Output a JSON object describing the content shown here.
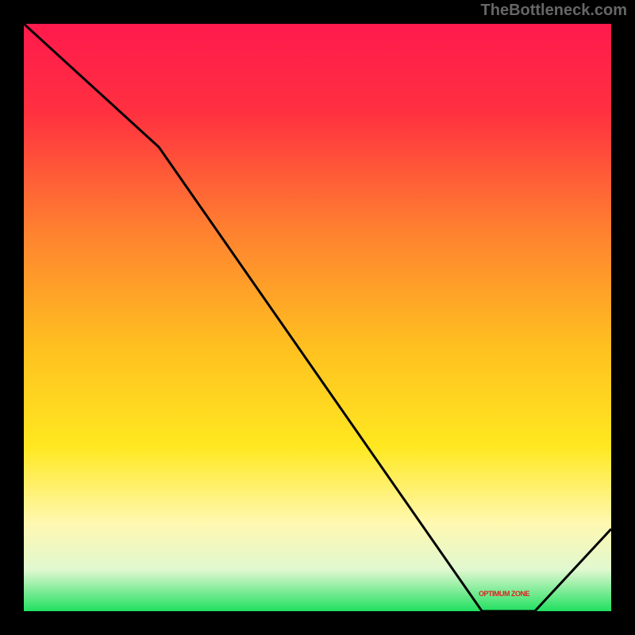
{
  "attribution": "TheBottleneck.com",
  "annotation": "OPTIMUM ZONE",
  "chart_data": {
    "type": "line",
    "title": "",
    "xlabel": "",
    "ylabel": "",
    "x": [
      0,
      23,
      78,
      87,
      100
    ],
    "values": [
      100,
      79,
      0,
      0,
      14
    ],
    "ylim": [
      0,
      100
    ],
    "xlim": [
      0,
      100
    ],
    "background_gradient": {
      "description": "vertical rainbow gradient from red/pink at top through orange, yellow, pale yellow to green at bottom representing bottleneck severity",
      "stops": [
        {
          "pos": 0,
          "color": "#ff1a4d"
        },
        {
          "pos": 15,
          "color": "#ff3040"
        },
        {
          "pos": 35,
          "color": "#ff8030"
        },
        {
          "pos": 55,
          "color": "#ffc020"
        },
        {
          "pos": 72,
          "color": "#ffe820"
        },
        {
          "pos": 85,
          "color": "#fff8b0"
        },
        {
          "pos": 93,
          "color": "#e0f8d0"
        },
        {
          "pos": 100,
          "color": "#20e060"
        }
      ]
    },
    "line_color": "#000000",
    "optimum_zone_x": [
      78,
      87
    ]
  }
}
